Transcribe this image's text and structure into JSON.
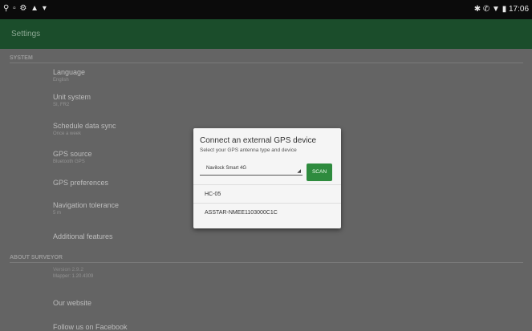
{
  "status_bar": {
    "left_icons": "⚲ ▫ ⚙ ▲ ▾",
    "right": "✱ ✆ ▼ ▮ 17:06"
  },
  "app_bar": {
    "title": "Settings"
  },
  "sections": [
    {
      "header": "SYSTEM",
      "items": [
        {
          "title": "Language",
          "subtitle": "English"
        },
        {
          "title": "Unit system",
          "subtitle": "SI, FR2"
        },
        {
          "title": "Schedule data sync",
          "subtitle": "Once a week"
        },
        {
          "title": "GPS source",
          "subtitle": "Bluetooth GPS"
        },
        {
          "title": "GPS preferences",
          "subtitle": ""
        },
        {
          "title": "Navigation tolerance",
          "subtitle": "5 m"
        },
        {
          "title": "Additional features",
          "subtitle": ""
        }
      ]
    },
    {
      "header": "ABOUT SURVEYOR",
      "items": [
        {
          "title": "Version 2.9.2",
          "subtitle": "Mapper: 1.20.4309"
        },
        {
          "title": "Our website",
          "subtitle": ""
        },
        {
          "title": "Follow us on Facebook",
          "subtitle": ""
        }
      ]
    }
  ],
  "dialog": {
    "title": "Connect an external GPS device",
    "subtitle": "Select your GPS antenna type and device",
    "antenna_select": {
      "value": "Navilock Smart 4G",
      "arrow": "◢"
    },
    "scan_label": "SCAN",
    "devices": [
      "HC-05",
      "ASSTAR-NMEE1103000C1C"
    ]
  }
}
